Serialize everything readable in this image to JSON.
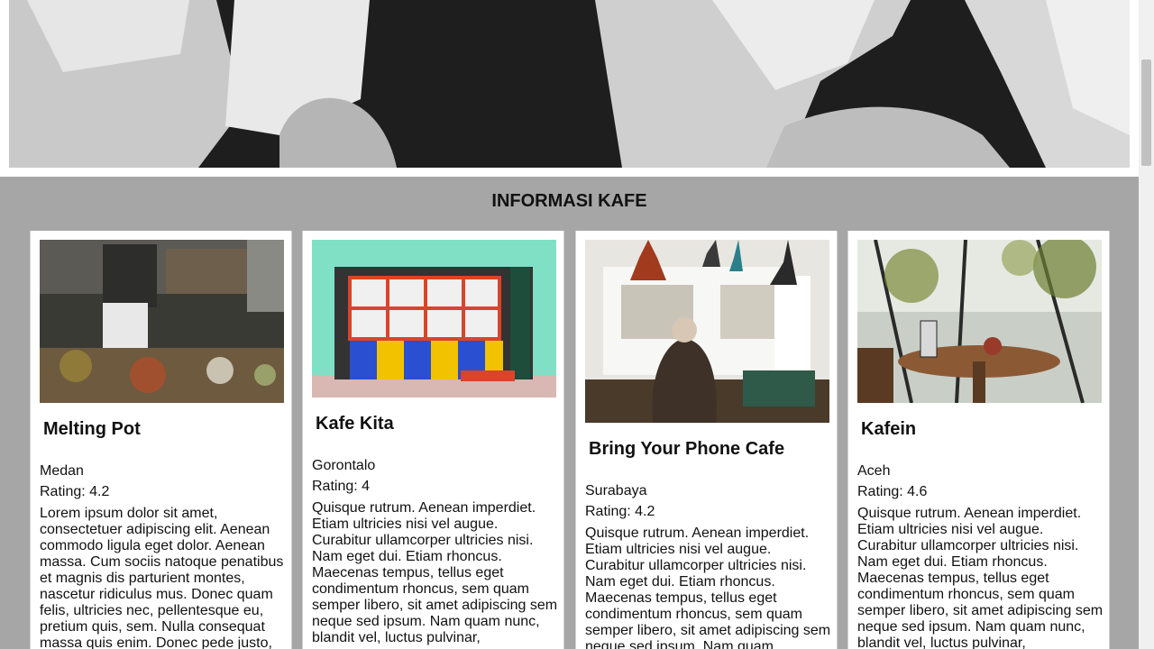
{
  "section": {
    "title": "INFORMASI KAFE"
  },
  "cards": [
    {
      "name": "Melting Pot",
      "city": "Medan",
      "rating": "Rating: 4.2",
      "description": "Lorem ipsum dolor sit amet, consectetuer adipiscing elit. Aenean commodo ligula eget dolor. Aenean massa. Cum sociis natoque penatibus et magnis dis parturient montes, nascetur ridiculus mus. Donec quam felis, ultricies nec, pellentesque eu, pretium quis, sem. Nulla consequat massa quis enim. Donec pede justo,"
    },
    {
      "name": "Kafe Kita",
      "city": "Gorontalo",
      "rating": "Rating: 4",
      "description": "Quisque rutrum. Aenean imperdiet. Etiam ultricies nisi vel augue. Curabitur ullamcorper ultricies nisi. Nam eget dui. Etiam rhoncus. Maecenas tempus, tellus eget condimentum rhoncus, sem quam semper libero, sit amet adipiscing sem neque sed ipsum. Nam quam nunc, blandit vel, luctus pulvinar,"
    },
    {
      "name": "Bring Your Phone Cafe",
      "city": "Surabaya",
      "rating": "Rating: 4.2",
      "description": "Quisque rutrum. Aenean imperdiet. Etiam ultricies nisi vel augue. Curabitur ullamcorper ultricies nisi. Nam eget dui. Etiam rhoncus. Maecenas tempus, tellus eget condimentum rhoncus, sem quam semper libero, sit amet adipiscing sem neque sed ipsum. Nam quam"
    },
    {
      "name": "Kafein",
      "city": "Aceh",
      "rating": "Rating: 4.6",
      "description": "Quisque rutrum. Aenean imperdiet. Etiam ultricies nisi vel augue. Curabitur ullamcorper ultricies nisi. Nam eget dui. Etiam rhoncus. Maecenas tempus, tellus eget condimentum rhoncus, sem quam semper libero, sit amet adipiscing sem neque sed ipsum. Nam quam nunc, blandit vel, luctus pulvinar,"
    }
  ]
}
